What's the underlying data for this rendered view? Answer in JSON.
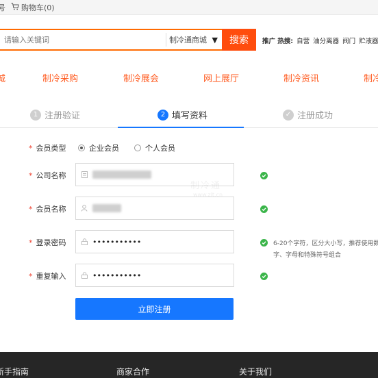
{
  "topbar": {
    "left_fragment": "号",
    "cart_label": "购物车(0)"
  },
  "search": {
    "placeholder": "请输入关键词",
    "scope": "制冷通商城",
    "button": "搜索",
    "hot_label": "推广 热搜:",
    "hot_terms": [
      "自营",
      "油分离器",
      "阀门",
      "贮液器"
    ]
  },
  "nav": {
    "items": [
      "城",
      "制冷采购",
      "制冷展会",
      "网上展厅",
      "制冷资讯",
      "制冷"
    ]
  },
  "steps": [
    {
      "num": "1",
      "label": "注册验证",
      "state": "pending"
    },
    {
      "num": "2",
      "label": "填写资料",
      "state": "active"
    },
    {
      "num": "✓",
      "label": "注册成功",
      "state": "pending"
    }
  ],
  "form": {
    "member_type": {
      "label": "会员类型",
      "options": [
        "企业会员",
        "个人会员"
      ],
      "selected": "企业会员"
    },
    "company": {
      "label": "公司名称"
    },
    "member_name": {
      "label": "会员名称"
    },
    "password": {
      "label": "登录密码",
      "value": "•••••••••••"
    },
    "confirm": {
      "label": "重复输入",
      "value": "•••••••••••"
    },
    "password_hint": "6-20个字符，区分大小写，推荐使用数字、字母和特殊符号组合",
    "submit": "立即注册"
  },
  "watermark": {
    "line1": "制冷通",
    "line2": "www.zlt.cn"
  },
  "footer": {
    "columns": [
      "新手指南",
      "商家合作",
      "关于我们"
    ]
  },
  "colors": {
    "accent_orange": "#ff4d0d",
    "nav_orange": "#ff5a1f",
    "primary_blue": "#1677ff",
    "success_green": "#3bb54a"
  }
}
